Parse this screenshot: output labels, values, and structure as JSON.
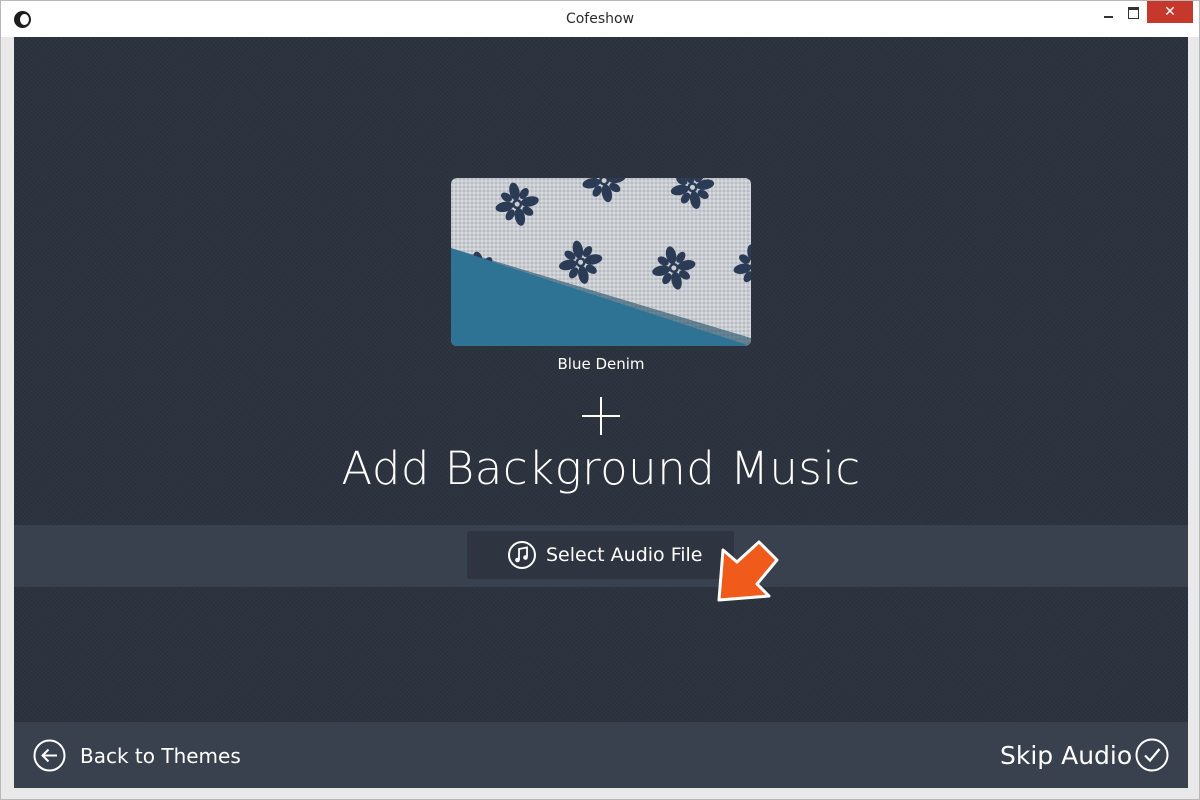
{
  "window": {
    "title": "Cofeshow",
    "icon": "cofeshow-app-icon",
    "controls": {
      "minimize": "minimize-icon",
      "maximize": "maximize-icon",
      "close_label": "✕"
    }
  },
  "theme": {
    "name": "Blue Denim",
    "colors": {
      "fabric": "#c9cdd2",
      "pattern": "#2b3a55",
      "denim": "#2e7394"
    }
  },
  "main": {
    "plus_icon": "plus-icon",
    "heading": "Add Background Music",
    "select_button": {
      "label": "Select Audio File",
      "icon": "music-note-icon"
    },
    "pointer_icon": "arrow-pointer-icon"
  },
  "footer": {
    "back": {
      "label": "Back to Themes",
      "icon": "circle-arrow-left-icon"
    },
    "skip": {
      "label": "Skip Audio",
      "icon": "circle-check-icon"
    }
  },
  "colors": {
    "background": "#2d333e",
    "band": "#3a414e",
    "accent_arrow": "#f05a1a",
    "close_button": "#c7382c"
  }
}
